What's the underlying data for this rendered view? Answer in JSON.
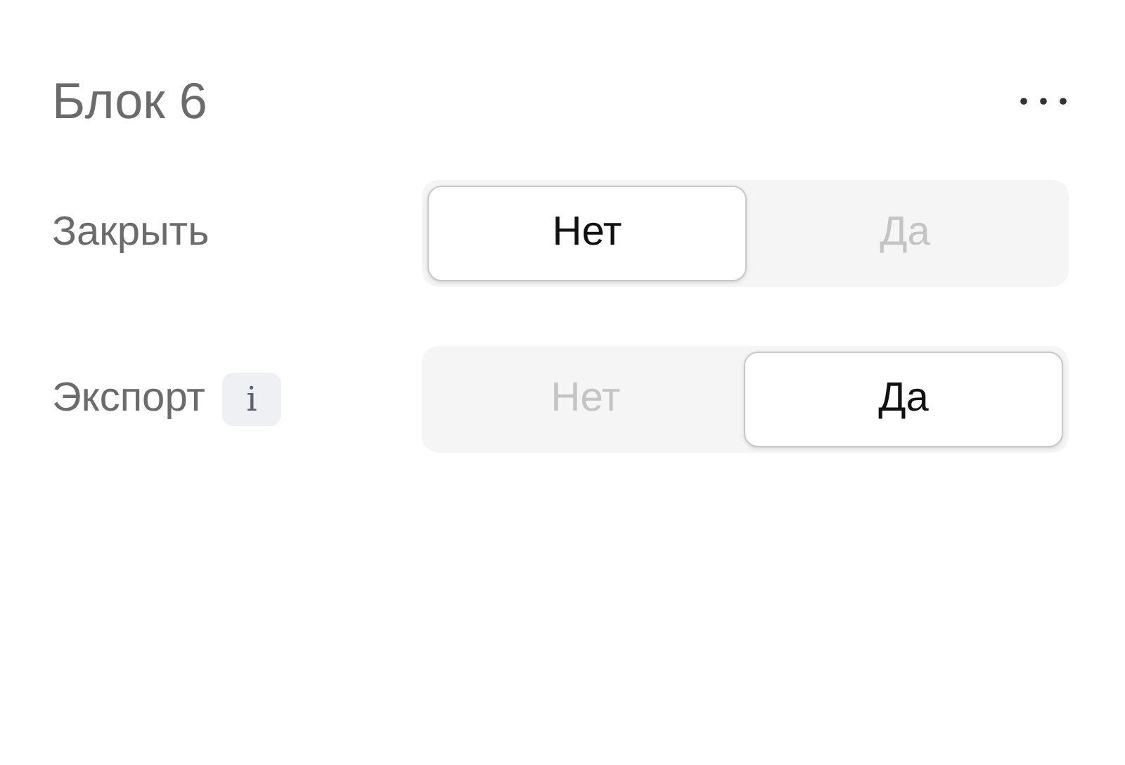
{
  "title": "Блок 6",
  "rows": [
    {
      "label": "Закрыть",
      "options": [
        {
          "label": "Нет",
          "selected": true
        },
        {
          "label": "Да",
          "selected": false
        }
      ]
    },
    {
      "label": "Экспорт",
      "info_badge": "i",
      "options": [
        {
          "label": "Нет",
          "selected": false
        },
        {
          "label": "Да",
          "selected": true
        }
      ]
    }
  ]
}
